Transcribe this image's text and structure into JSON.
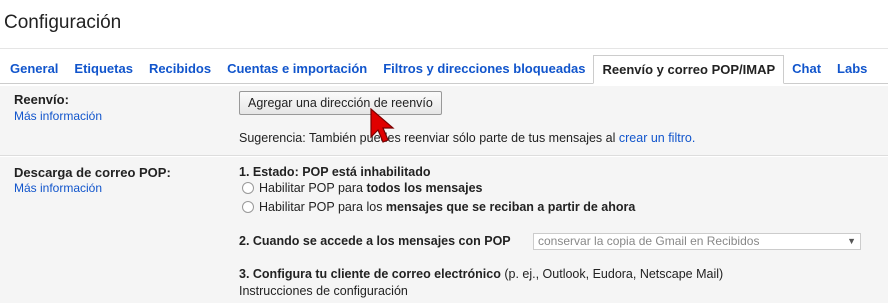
{
  "page": {
    "title": "Configuración"
  },
  "tabs": [
    {
      "label": "General"
    },
    {
      "label": "Etiquetas"
    },
    {
      "label": "Recibidos"
    },
    {
      "label": "Cuentas e importación"
    },
    {
      "label": "Filtros y direcciones bloqueadas"
    },
    {
      "label": "Reenvío y correo POP/IMAP",
      "active": true
    },
    {
      "label": "Chat"
    },
    {
      "label": "Labs"
    }
  ],
  "forwarding": {
    "label": "Reenvío:",
    "more_info": "Más información",
    "add_button": "Agregar una dirección de reenvío",
    "hint_prefix": "Sugerencia: También puedes reenviar sólo parte de tus mensajes al",
    "hint_link": "crear un filtro."
  },
  "pop": {
    "label": "Descarga de correo POP:",
    "more_info": "Más información",
    "status_heading": "1. Estado: POP está inhabilitado",
    "option1_prefix": "Habilitar POP para",
    "option1_bold": "todos los mensajes",
    "option2_prefix": "Habilitar POP para los",
    "option2_bold": "mensajes que se reciban a partir de ahora",
    "access_heading": "2. Cuando se accede a los mensajes con POP",
    "access_select_value": "conservar la copia de Gmail en Recibidos",
    "client_heading": "3. Configura tu cliente de correo electrónico",
    "client_examples": "(p. ej., Outlook, Eudora, Netscape Mail)",
    "client_link": "Instrucciones de configuración"
  },
  "colors": {
    "link": "#1155cc",
    "section_bg": "#f5f5f5",
    "cursor": "#e00000"
  }
}
